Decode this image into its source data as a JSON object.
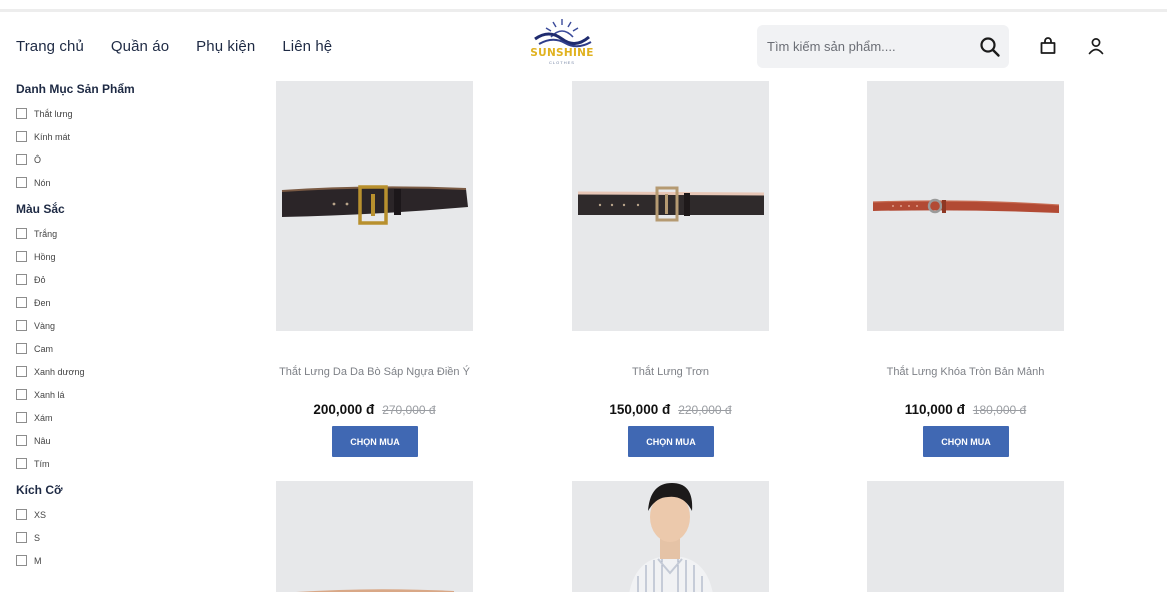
{
  "nav": {
    "items": [
      "Trang chủ",
      "Quần áo",
      "Phụ kiện",
      "Liên hệ"
    ]
  },
  "logo": {
    "text": "SUNSHINE",
    "subtext": "CLOTHES",
    "color": "#e0b220",
    "icon": "sun-wave-logo-icon"
  },
  "search": {
    "placeholder": "Tìm kiếm sản phẩm....",
    "value": "",
    "icon": "search-icon"
  },
  "header_icons": [
    "shopping-bag-icon",
    "user-icon"
  ],
  "filters": {
    "category": {
      "title": "Danh Mục Sản Phẩm",
      "options": [
        "Thắt lưng",
        "Kính mát",
        "Ô",
        "Nón"
      ]
    },
    "color": {
      "title": "Màu Sắc",
      "options": [
        "Trắng",
        "Hồng",
        "Đỏ",
        "Đen",
        "Vàng",
        "Cam",
        "Xanh dương",
        "Xanh lá",
        "Xám",
        "Nâu",
        "Tím"
      ]
    },
    "size": {
      "title": "Kích Cỡ",
      "options": [
        "XS",
        "S",
        "M"
      ]
    }
  },
  "products": [
    {
      "name": "Thắt Lưng Da Da Bò Sáp Ngựa Điền Ý",
      "price": "200,000 đ",
      "old_price": "270,000 đ",
      "button": "CHỌN MUA"
    },
    {
      "name": "Thắt Lưng Trơn",
      "price": "150,000 đ",
      "old_price": "220,000 đ",
      "button": "CHỌN MUA"
    },
    {
      "name": "Thắt Lưng Khóa Tròn Bản Mảnh",
      "price": "110,000 đ",
      "old_price": "180,000 đ",
      "button": "CHỌN MUA"
    }
  ],
  "colors": {
    "button_bg": "#4068b3",
    "image_bg": "#e7e8ea",
    "search_bg": "#f1f2f4"
  }
}
